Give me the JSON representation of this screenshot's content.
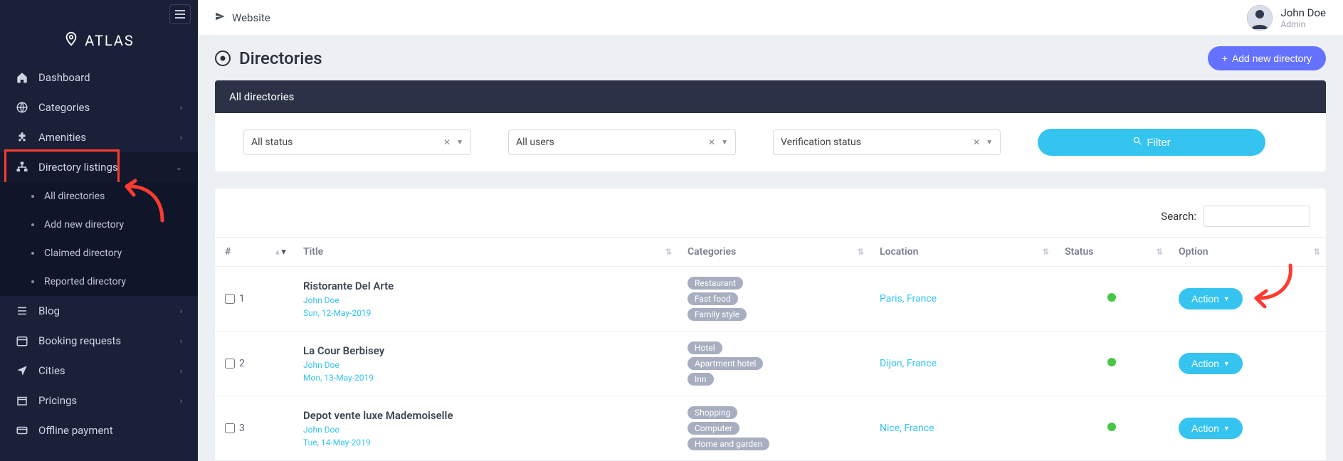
{
  "brand": {
    "name": "ATLAS"
  },
  "topbar": {
    "website_label": "Website",
    "user": {
      "name": "John Doe",
      "role": "Admin"
    }
  },
  "sidebar": {
    "items": [
      {
        "label": "Dashboard"
      },
      {
        "label": "Categories"
      },
      {
        "label": "Amenities"
      },
      {
        "label": "Directory listings"
      },
      {
        "label": "Blog"
      },
      {
        "label": "Booking requests"
      },
      {
        "label": "Cities"
      },
      {
        "label": "Pricings"
      },
      {
        "label": "Offline payment"
      }
    ],
    "sub_directory": [
      {
        "label": "All directories"
      },
      {
        "label": "Add new directory"
      },
      {
        "label": "Claimed directory"
      },
      {
        "label": "Reported directory"
      }
    ]
  },
  "page": {
    "title": "Directories",
    "add_button": "Add new directory",
    "panel_header": "All directories"
  },
  "filters": {
    "status": "All status",
    "users": "All users",
    "verification": "Verification status",
    "filter_button": "Filter"
  },
  "table": {
    "search_label": "Search:",
    "columns": {
      "idx": "#",
      "title": "Title",
      "categories": "Categories",
      "location": "Location",
      "status": "Status",
      "option": "Option"
    },
    "action_label": "Action",
    "rows": [
      {
        "idx": "1",
        "title": "Ristorante Del Arte",
        "author": "John Doe",
        "date": "Sun, 12-May-2019",
        "categories": [
          "Restaurant",
          "Fast food",
          "Family style"
        ],
        "location": "Paris, France"
      },
      {
        "idx": "2",
        "title": "La Cour Berbisey",
        "author": "John Doe",
        "date": "Mon, 13-May-2019",
        "categories": [
          "Hotel",
          "Apartment hotel",
          "Inn"
        ],
        "location": "Dijon, France"
      },
      {
        "idx": "3",
        "title": "Depot vente luxe Mademoiselle",
        "author": "John Doe",
        "date": "Tue, 14-May-2019",
        "categories": [
          "Shopping",
          "Computer",
          "Home and garden"
        ],
        "location": "Nice, France"
      }
    ]
  }
}
